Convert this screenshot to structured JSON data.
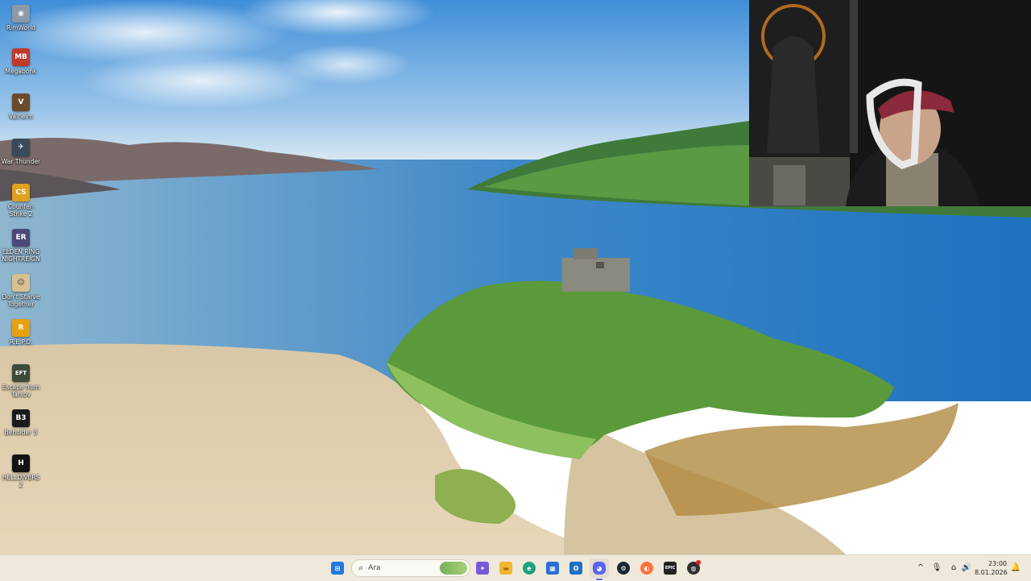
{
  "desktop": {
    "icons": [
      {
        "label": "RimWorld",
        "icon": "rimworld-icon",
        "color": "#8a9aa8",
        "glyph": "◉"
      },
      {
        "label": "Megabonk",
        "icon": "megabonk-icon",
        "color": "#c0392b",
        "glyph": "MB"
      },
      {
        "label": "Valheim",
        "icon": "valheim-icon",
        "color": "#6b4a2b",
        "glyph": "V"
      },
      {
        "label": "War Thunder",
        "icon": "war-thunder-icon",
        "color": "#3a4a5a",
        "glyph": "✈"
      },
      {
        "label": "Counter-Strike 2",
        "icon": "counter-strike-icon",
        "color": "#e0a020",
        "glyph": "CS"
      },
      {
        "label": "ELDEN RING NIGHTREIGN",
        "icon": "elden-ring-icon",
        "color": "#4a4a7a",
        "glyph": "ER"
      },
      {
        "label": "Don't Starve Together",
        "icon": "dont-starve-icon",
        "color": "#d8c090",
        "glyph": "☺"
      },
      {
        "label": "R.E.P.O.",
        "icon": "repo-icon",
        "color": "#e8a010",
        "glyph": "R"
      },
      {
        "label": "Escape from Tarkov",
        "icon": "tarkov-icon",
        "color": "#3e4a3a",
        "glyph": "EFT"
      },
      {
        "label": "Beholder 3",
        "icon": "beholder-icon",
        "color": "#1a1a1a",
        "glyph": "B3"
      },
      {
        "label": "HELLDIVERS 2",
        "icon": "helldivers-icon",
        "color": "#111111",
        "glyph": "H"
      }
    ]
  },
  "taskbar": {
    "search_placeholder": "Ara",
    "apps": [
      {
        "name": "start-button",
        "icon": "windows-start-icon",
        "color": "#1f7ae0",
        "glyph": "⊞",
        "active": false
      },
      {
        "name": "copilot-button",
        "icon": "copilot-icon",
        "color": "#7a5ad8",
        "glyph": "✦",
        "active": false
      },
      {
        "name": "file-explorer-button",
        "icon": "folder-icon",
        "color": "#f2b632",
        "glyph": "▬",
        "active": false
      },
      {
        "name": "edge-button",
        "icon": "edge-icon",
        "color": "#1fa17a",
        "glyph": "e",
        "active": false
      },
      {
        "name": "store-button",
        "icon": "store-icon",
        "color": "#2a6fd6",
        "glyph": "▦",
        "active": false
      },
      {
        "name": "outlook-button",
        "icon": "outlook-icon",
        "color": "#1e6fc2",
        "glyph": "O",
        "active": false
      },
      {
        "name": "discord-button",
        "icon": "discord-icon",
        "color": "#5865f2",
        "glyph": "◕",
        "active": true
      },
      {
        "name": "steam-button",
        "icon": "steam-icon",
        "color": "#1b2838",
        "glyph": "⚙",
        "active": false
      },
      {
        "name": "firefox-button",
        "icon": "firefox-icon",
        "color": "#ff7139",
        "glyph": "◐",
        "active": false
      },
      {
        "name": "epic-games-button",
        "icon": "epic-games-icon",
        "color": "#222222",
        "glyph": "EPIC",
        "active": false
      },
      {
        "name": "obs-button",
        "icon": "obs-icon",
        "color": "#302e31",
        "glyph": "◍",
        "active": false
      }
    ],
    "tray": {
      "chevron": "^",
      "mic": "🎙",
      "network": "⌂",
      "volume": "🔊",
      "notification": "🔔"
    },
    "time": "23:00",
    "date": "8.01.2026"
  }
}
